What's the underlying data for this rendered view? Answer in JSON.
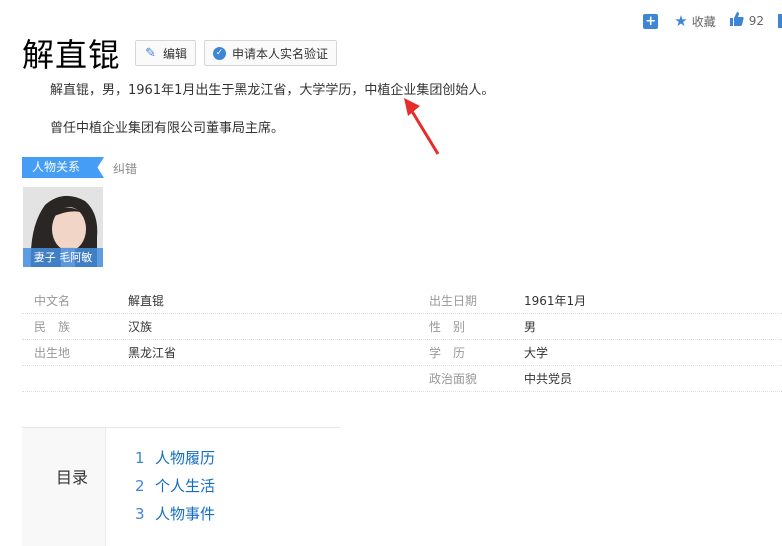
{
  "toolbar": {
    "add_icon": "plus-square-icon",
    "favorite_label": "收藏",
    "like_count": "92",
    "accent": "#3f85d6"
  },
  "header": {
    "title": "解直锟",
    "edit_label": "编辑",
    "verify_label": "申请本人实名验证"
  },
  "summary": {
    "line1": "解直锟，男，1961年1月出生于黑龙江省，大学学历，中植企业集团创始人。",
    "line2": "曾任中植企业集团有限公司董事局主席。"
  },
  "relations": {
    "tab_label": "人物关系",
    "error_label": "纠错",
    "cards": [
      {
        "caption": "妻子 毛阿敏"
      }
    ]
  },
  "basic_info": {
    "rows": [
      {
        "k1": "中文名",
        "v1": "解直锟",
        "k2": "出生日期",
        "v2": "1961年1月"
      },
      {
        "k1": "民　族",
        "v1": "汉族",
        "k2": "性　别",
        "v2": "男"
      },
      {
        "k1": "出生地",
        "v1": "黑龙江省",
        "k2": "学　历",
        "v2": "大学"
      },
      {
        "k1": "",
        "v1": "",
        "k2": "政治面貌",
        "v2": "中共党员"
      }
    ]
  },
  "toc": {
    "label": "目录",
    "items": [
      {
        "num": "1",
        "text": "人物履历"
      },
      {
        "num": "2",
        "text": "个人生活"
      },
      {
        "num": "3",
        "text": "人物事件"
      }
    ]
  }
}
